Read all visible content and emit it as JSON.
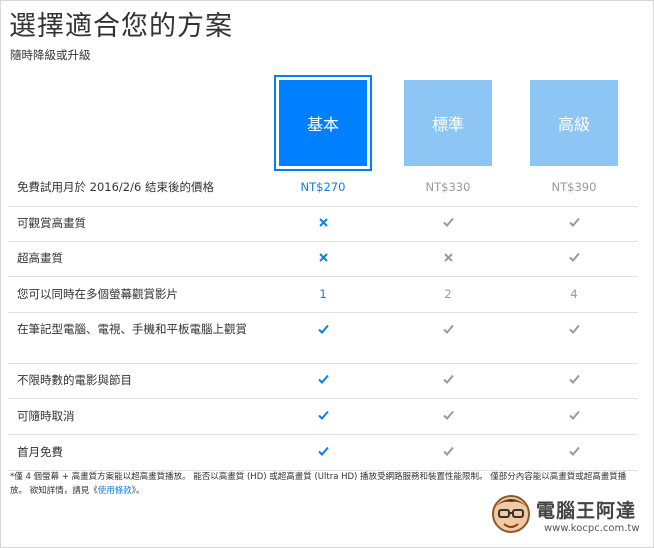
{
  "page": {
    "title": "選擇適合您的方案",
    "subtitle": "隨時降級或升級"
  },
  "plans": [
    {
      "name": "基本",
      "price": "NT$270"
    },
    {
      "name": "標準",
      "price": "NT$330"
    },
    {
      "name": "高級",
      "price": "NT$390"
    }
  ],
  "price_row_label": "免費試用月於 2016/2/6 結束後的價格",
  "features": [
    {
      "label": "可觀賞高畫質",
      "values": [
        "cross",
        "check",
        "check"
      ]
    },
    {
      "label": "超高畫質",
      "values": [
        "cross",
        "cross",
        "check"
      ]
    },
    {
      "label": "您可以同時在多個螢幕觀賞影片",
      "values": [
        "1",
        "2",
        "4"
      ]
    },
    {
      "label": "在筆記型電腦、電視、手機和平板電腦上觀賞",
      "values": [
        "check",
        "check",
        "check"
      ]
    },
    {
      "label": "不限時數的電影與節目",
      "values": [
        "check",
        "check",
        "check"
      ]
    },
    {
      "label": "可隨時取消",
      "values": [
        "check",
        "check",
        "check"
      ]
    },
    {
      "label": "首月免費",
      "values": [
        "check",
        "check",
        "check"
      ]
    }
  ],
  "footnote": {
    "text": "*僅 4 個螢幕 + 高畫質方案能以超高畫質播放。 能否以高畫質 (HD) 或超高畫質 (Ultra HD) 播放受網路服務和裝置性能限制。 僅部分內容能以高畫質或超高畫質播放。 欲知詳情，請見《",
    "link": "使用條款",
    "suffix": "》。"
  },
  "watermark": {
    "brand": "電腦王阿達",
    "url": "www.kocpc.com.tw"
  },
  "colors": {
    "selected": "#0080ff",
    "unselected": "#8dc6f5",
    "accent_text": "#0f7ee0",
    "muted_text": "#9a9a9a"
  }
}
